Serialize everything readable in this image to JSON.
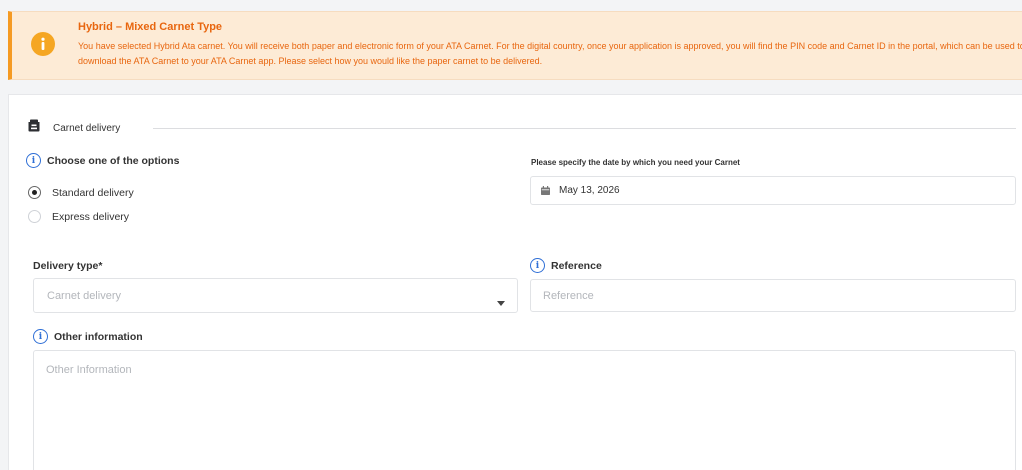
{
  "alert": {
    "title": "Hybrid – Mixed Carnet Type",
    "text": "You have selected Hybrid Ata carnet. You will receive both paper and electronic form of your ATA Carnet. For the digital country, once your application is approved, you will find the PIN code and Carnet ID in the portal, which can be used to download the ATA Carnet to your ATA Carnet app. Please select how you would like the paper carnet to be delivered.",
    "icon": "info-icon",
    "color": "#e8660f",
    "background": "#fdebd6"
  },
  "section": {
    "title": "Carnet delivery",
    "icon": "delivery-box-icon"
  },
  "options": {
    "label": "Choose one of the options",
    "items": [
      {
        "label": "Standard delivery",
        "checked": true
      },
      {
        "label": "Express delivery",
        "checked": false
      }
    ]
  },
  "date": {
    "caption": "Please specify the date by which you need your Carnet",
    "value": "May 13, 2026",
    "icon": "calendar-icon"
  },
  "delivery_type": {
    "label": "Delivery type*",
    "placeholder": "Carnet delivery"
  },
  "reference": {
    "label": "Reference",
    "placeholder": "Reference"
  },
  "other": {
    "label": "Other information",
    "placeholder": "Other Information"
  },
  "colors": {
    "accent_info": "#2f6fd6",
    "warning": "#f5a623"
  }
}
